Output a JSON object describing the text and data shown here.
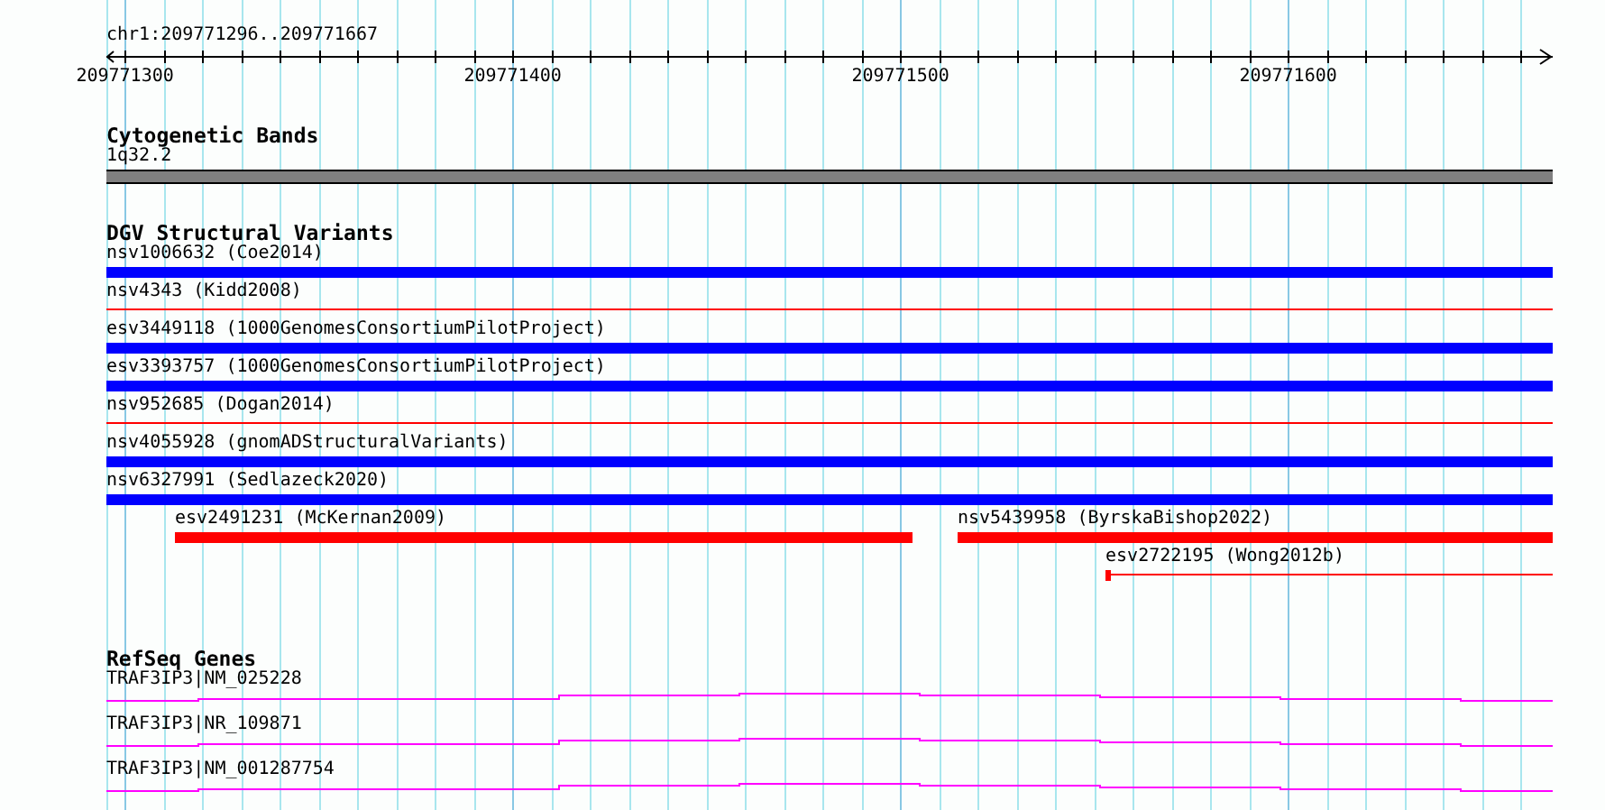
{
  "location": "chr1:209771296..209771667",
  "ruler": {
    "ticks": [
      "209771300",
      "209771400",
      "209771500",
      "209771600"
    ]
  },
  "tracks": [
    {
      "kind": "cytoband",
      "title": "Cytogenetic Bands",
      "bands": [
        {
          "label": "1q32.2"
        }
      ]
    },
    {
      "kind": "variants",
      "title": "DGV Structural Variants",
      "lanes": [
        {
          "features": [
            {
              "label": "nsv1006632 (Coe2014)",
              "kind": "thick",
              "color": "#0000ff"
            }
          ]
        },
        {
          "features": [
            {
              "label": "nsv4343 (Kidd2008)",
              "kind": "thin",
              "color": "#ff0000"
            }
          ]
        },
        {
          "features": [
            {
              "label": "esv3449118 (1000GenomesConsortiumPilotProject)",
              "kind": "thick",
              "color": "#0000ff"
            }
          ]
        },
        {
          "features": [
            {
              "label": "esv3393757 (1000GenomesConsortiumPilotProject)",
              "kind": "thick",
              "color": "#0000ff"
            }
          ]
        },
        {
          "features": [
            {
              "label": "nsv952685 (Dogan2014)",
              "kind": "thin",
              "color": "#ff0000"
            }
          ]
        },
        {
          "features": [
            {
              "label": "nsv4055928 (gnomADStructuralVariants)",
              "kind": "thick",
              "color": "#0000ff"
            }
          ]
        },
        {
          "features": [
            {
              "label": "nsv6327991 (Sedlazeck2020)",
              "kind": "thick",
              "color": "#0000ff"
            }
          ]
        },
        {
          "features": [
            {
              "label": "esv2491231 (McKernan2009)",
              "kind": "thick",
              "color": "#ff0000"
            },
            {
              "label": "nsv5439958 (ByrskaBishop2022)",
              "kind": "thick",
              "color": "#ff0000"
            }
          ]
        },
        {
          "features": [
            {
              "label": "esv2722195 (Wong2012b)",
              "kind": "marked",
              "color": "#ff0000"
            }
          ]
        }
      ]
    },
    {
      "kind": "genes",
      "title": "RefSeq Genes",
      "genes": [
        {
          "label": "TRAF3IP3|NM_025228"
        },
        {
          "label": "TRAF3IP3|NR_109871"
        },
        {
          "label": "TRAF3IP3|NM_001287754"
        }
      ]
    }
  ]
}
